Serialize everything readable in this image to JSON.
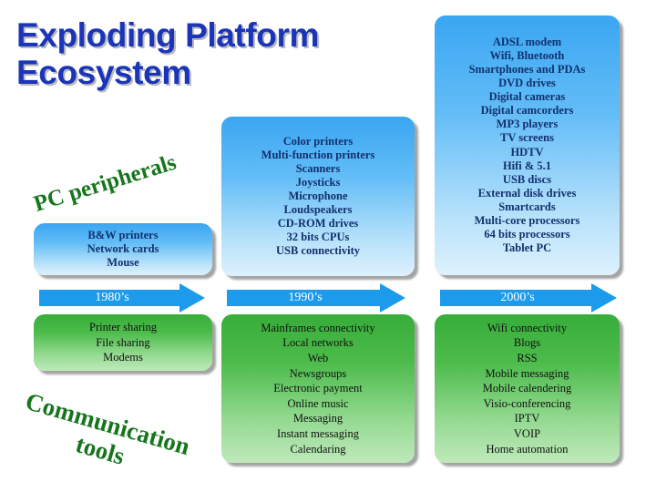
{
  "slide": {
    "title": "Exploding Platform\nEcosystem"
  },
  "category_labels": {
    "peripherals": "PC peripherals",
    "communication": "Communication\ntools"
  },
  "timeline": {
    "decades": [
      {
        "label": "1980’s"
      },
      {
        "label": "1990’s"
      },
      {
        "label": "2000’s"
      }
    ]
  },
  "peripherals_row": {
    "decade_1980s": "B&W printers\nNetwork cards\nMouse",
    "decade_1990s": "Color printers\nMulti-function printers\nScanners\nJoysticks\nMicrophone\nLoudspeakers\nCD-ROM drives\n32 bits CPUs\nUSB connectivity",
    "decade_2000s": "ADSL modem\nWifi, Bluetooth\nSmartphones and PDAs\nDVD drives\nDigital cameras\nDigital camcorders\nMP3 players\nTV screens\nHDTV\nHifi & 5.1\nUSB discs\nExternal disk drives\nSmartcards\nMulti-core processors\n64 bits processors\nTablet PC"
  },
  "communication_row": {
    "decade_1980s": "Printer sharing\nFile sharing\nModems",
    "decade_1990s": "Mainframes connectivity\nLocal networks\nWeb\nNewsgroups\nElectronic payment\nOnline music\nMessaging\nInstant messaging\nCalendaring",
    "decade_2000s": "Wifi connectivity\nBlogs\nRSS\nMobile messaging\nMobile calendering\nVisio-conferencing\nIPTV\nVOIP\nHome automation"
  },
  "colors": {
    "title_blue": "#1b35b8",
    "arrow_blue": "#1c9bed",
    "label_green": "#17761d",
    "box_blue_top": "#3aa6f2",
    "box_green_top": "#37ad3a"
  }
}
